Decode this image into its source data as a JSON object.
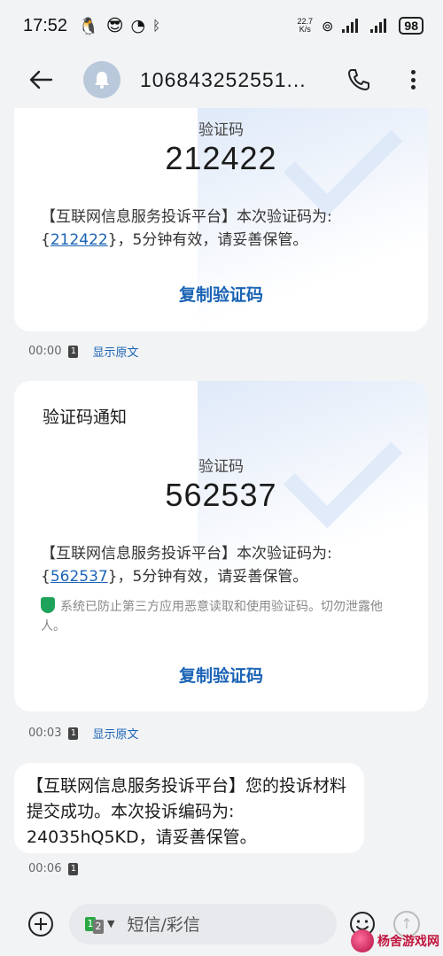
{
  "status_bar": {
    "time": "17:52",
    "speed_value": "22.7",
    "speed_unit": "K/s",
    "battery": "98"
  },
  "header": {
    "title": "106843252551..."
  },
  "messages": [
    {
      "type": "verification",
      "card_title": "",
      "code_label": "验证码",
      "code": "212422",
      "body_prefix": "【互联网信息服务投诉平台】本次验证码为:{",
      "body_code": "212422",
      "body_suffix": "}，5分钟有效，请妥善保管。",
      "copy_label": "复制验证码",
      "time": "00:00",
      "sim": "1",
      "show_original": "显示原文"
    },
    {
      "type": "verification",
      "card_title": "验证码通知",
      "code_label": "验证码",
      "code": "562537",
      "body_prefix": "【互联网信息服务投诉平台】本次验证码为:{",
      "body_code": "562537",
      "body_suffix": "}，5分钟有效，请妥善保管。",
      "notice": "系统已防止第三方应用恶意读取和使用验证码。切勿泄露他人。",
      "copy_label": "复制验证码",
      "time": "00:03",
      "sim": "1",
      "show_original": "显示原文"
    },
    {
      "type": "text",
      "text": "【互联网信息服务投诉平台】您的投诉材料提交成功。本次投诉编码为: 24035hQ5KD，请妥善保管。",
      "time": "00:06",
      "sim": "1"
    }
  ],
  "input_bar": {
    "sim_primary": "1",
    "sim_secondary": "2",
    "placeholder": "短信/彩信"
  },
  "watermark": {
    "text": "杨舍游戏网"
  },
  "colors": {
    "accent": "#1a63b5",
    "background": "#f1f3f5",
    "shield": "#1fa25a"
  }
}
